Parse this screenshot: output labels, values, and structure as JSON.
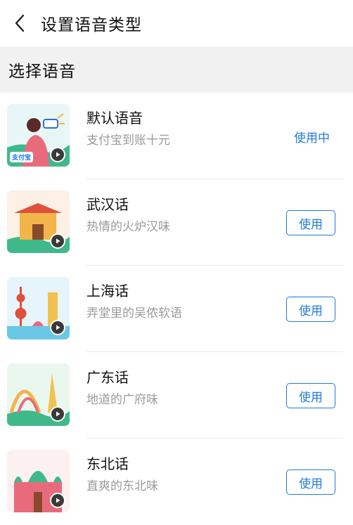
{
  "header": {
    "title": "设置语音类型"
  },
  "section": {
    "title": "选择语音"
  },
  "voices": [
    {
      "name": "默认语音",
      "desc": "支付宝到账十元",
      "status": "使用中",
      "logo_text": "支付宝"
    },
    {
      "name": "武汉话",
      "desc": "热情的火炉汉味",
      "button": "使用"
    },
    {
      "name": "上海话",
      "desc": "弄堂里的吴侬软语",
      "button": "使用"
    },
    {
      "name": "广东话",
      "desc": "地道的广府味",
      "button": "使用"
    },
    {
      "name": "东北话",
      "desc": "直爽的东北味",
      "button": "使用"
    }
  ],
  "colors": {
    "accent": "#1f7cd6",
    "section_bg": "#f1f1f1",
    "secondary_text": "#9a9a9a"
  },
  "icons": [
    "back-chevron-icon",
    "play-icon"
  ]
}
